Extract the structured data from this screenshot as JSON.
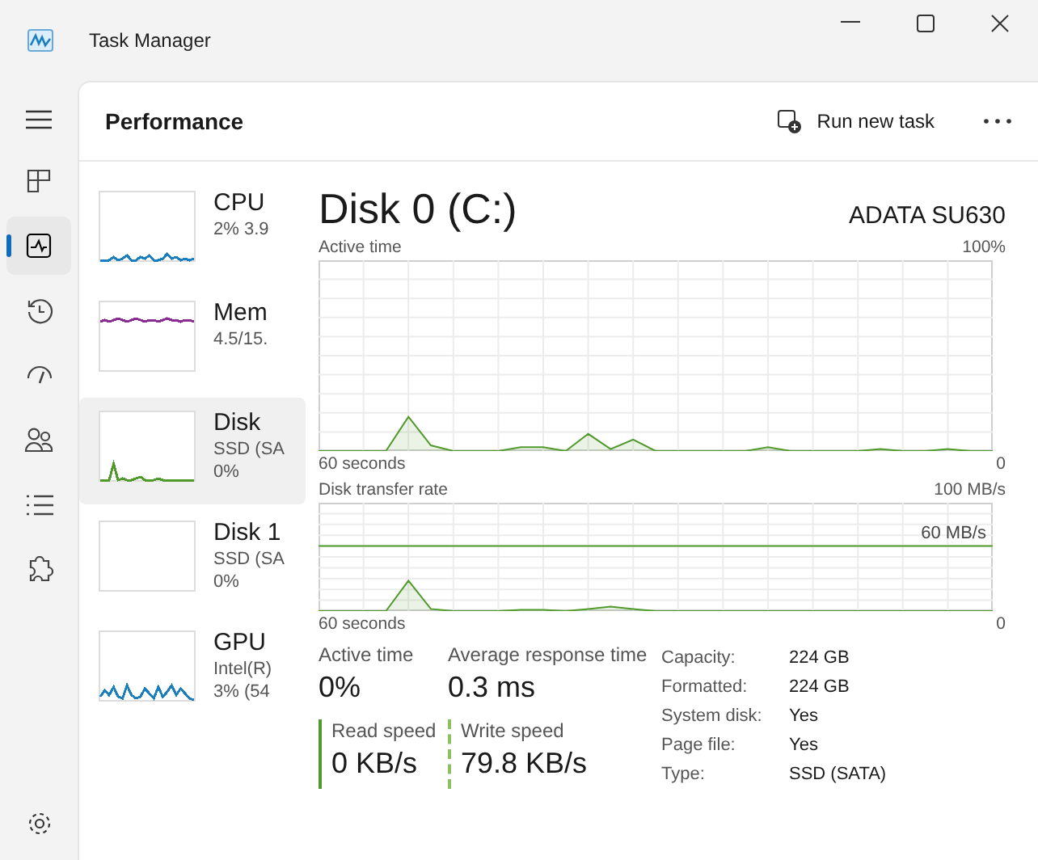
{
  "window": {
    "title": "Task Manager"
  },
  "nav": [
    {
      "kind": "processes",
      "selected": false
    },
    {
      "kind": "performance",
      "selected": true
    },
    {
      "kind": "history",
      "selected": false
    },
    {
      "kind": "startup",
      "selected": false
    },
    {
      "kind": "users",
      "selected": false
    },
    {
      "kind": "details",
      "selected": false
    },
    {
      "kind": "services",
      "selected": false
    }
  ],
  "header": {
    "title": "Performance",
    "run_task": "Run new task"
  },
  "devices": [
    {
      "name": "CPU",
      "lines": [
        "2% 3.9"
      ],
      "selected": false,
      "color": "#1a7fc1"
    },
    {
      "name": "Mem",
      "lines": [
        "4.5/15."
      ],
      "selected": false,
      "color": "#8b2c93"
    },
    {
      "name": "Disk",
      "lines": [
        "SSD (SA",
        "0%"
      ],
      "selected": true,
      "color": "#4f9a2a"
    },
    {
      "name": "Disk 1",
      "lines": [
        "SSD (SA",
        "0%"
      ],
      "selected": false
    },
    {
      "name": "GPU",
      "lines": [
        "Intel(R)",
        "3% (54"
      ],
      "selected": false,
      "color": "#1a7fc1"
    }
  ],
  "detail": {
    "title": "Disk 0 (C:)",
    "model": "ADATA SU630",
    "charts": [
      {
        "title": "Active time",
        "max_label": "100%",
        "start_label": "60 seconds",
        "end_label": "0"
      },
      {
        "title": "Disk transfer rate",
        "max_label": "100 MB/s",
        "start_label": "60 seconds",
        "end_label": "0",
        "reference_label": "60 MB/s"
      }
    ],
    "stats": [
      {
        "kind": "plain",
        "label": "Active time",
        "value": "0%"
      },
      {
        "kind": "plain",
        "label": "Average response time",
        "value": "0.3 ms"
      },
      {
        "kind": "solid",
        "label": "Read speed",
        "value": "0 KB/s"
      },
      {
        "kind": "dashed",
        "label": "Write speed",
        "value": "79.8 KB/s"
      }
    ],
    "properties": [
      {
        "label": "Capacity:",
        "value": "224 GB"
      },
      {
        "label": "Formatted:",
        "value": "224 GB"
      },
      {
        "label": "System disk:",
        "value": "Yes"
      },
      {
        "label": "Page file:",
        "value": "Yes"
      },
      {
        "label": "Type:",
        "value": "SSD (SATA)"
      }
    ]
  }
}
